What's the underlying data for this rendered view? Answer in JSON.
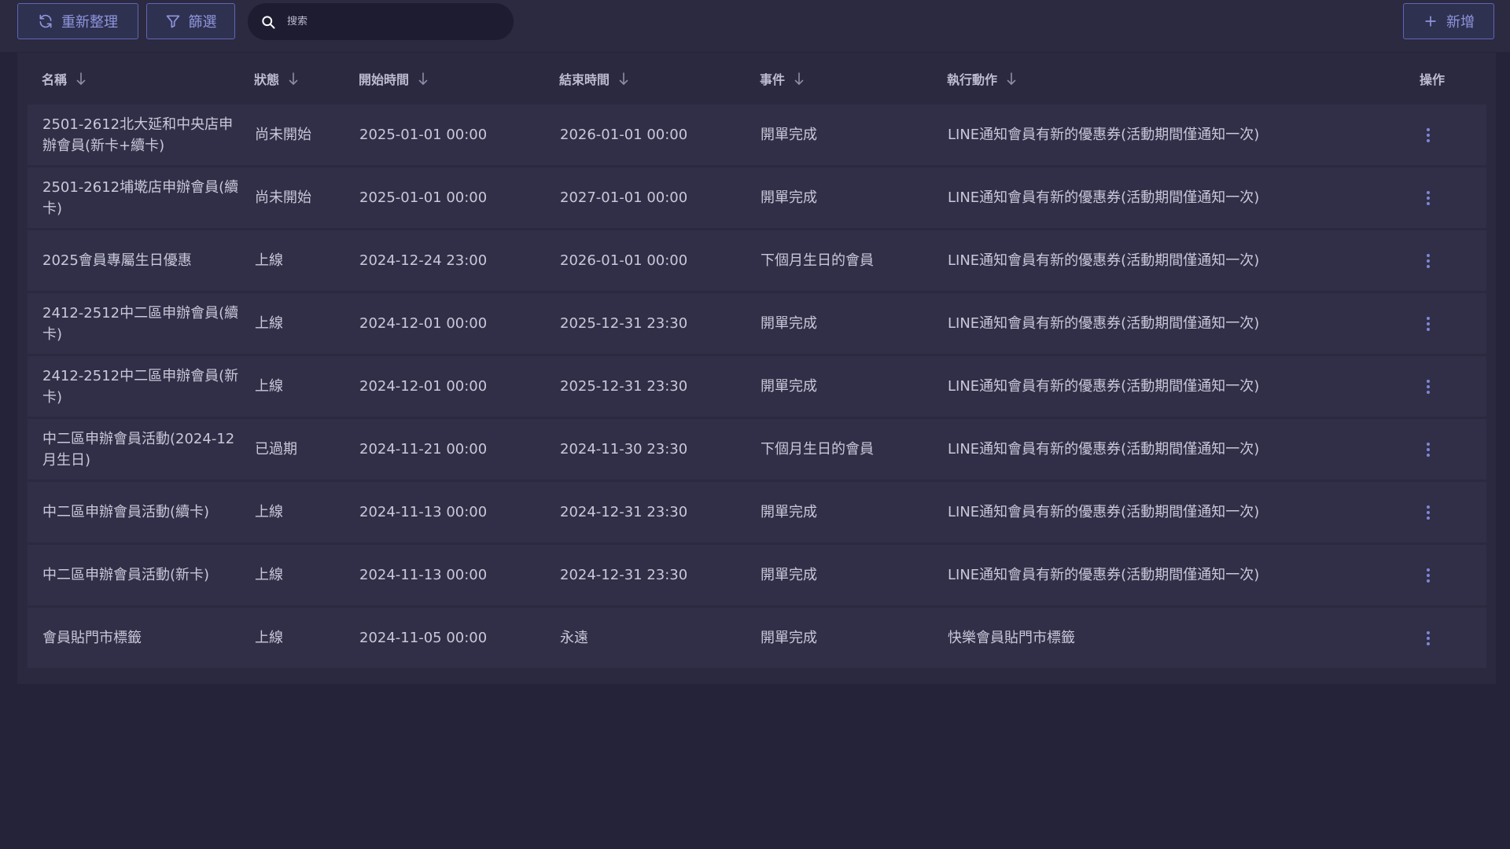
{
  "toolbar": {
    "refresh_label": "重新整理",
    "filter_label": "篩選",
    "add_label": "新增",
    "search_placeholder": "搜索"
  },
  "table": {
    "columns": [
      "名稱",
      "狀態",
      "開始時間",
      "結束時間",
      "事件",
      "執行動作",
      "操作"
    ],
    "rows": [
      {
        "name": "2501-2612北大延和中央店申辦會員(新卡+續卡)",
        "status": "尚未開始",
        "start": "2025-01-01 00:00",
        "end": "2026-01-01 00:00",
        "event": "開單完成",
        "action": "LINE通知會員有新的優惠券(活動期間僅通知一次)"
      },
      {
        "name": "2501-2612埔墘店申辦會員(續卡)",
        "status": "尚未開始",
        "start": "2025-01-01 00:00",
        "end": "2027-01-01 00:00",
        "event": "開單完成",
        "action": "LINE通知會員有新的優惠券(活動期間僅通知一次)"
      },
      {
        "name": "2025會員專屬生日優惠",
        "status": "上線",
        "start": "2024-12-24 23:00",
        "end": "2026-01-01 00:00",
        "event": "下個月生日的會員",
        "action": "LINE通知會員有新的優惠券(活動期間僅通知一次)"
      },
      {
        "name": "2412-2512中二區申辦會員(續卡)",
        "status": "上線",
        "start": "2024-12-01 00:00",
        "end": "2025-12-31 23:30",
        "event": "開單完成",
        "action": "LINE通知會員有新的優惠券(活動期間僅通知一次)"
      },
      {
        "name": "2412-2512中二區申辦會員(新卡)",
        "status": "上線",
        "start": "2024-12-01 00:00",
        "end": "2025-12-31 23:30",
        "event": "開單完成",
        "action": "LINE通知會員有新的優惠券(活動期間僅通知一次)"
      },
      {
        "name": "中二區申辦會員活動(2024-12月生日)",
        "status": "已過期",
        "start": "2024-11-21 00:00",
        "end": "2024-11-30 23:30",
        "event": "下個月生日的會員",
        "action": "LINE通知會員有新的優惠券(活動期間僅通知一次)"
      },
      {
        "name": "中二區申辦會員活動(續卡)",
        "status": "上線",
        "start": "2024-11-13 00:00",
        "end": "2024-12-31 23:30",
        "event": "開單完成",
        "action": "LINE通知會員有新的優惠券(活動期間僅通知一次)"
      },
      {
        "name": "中二區申辦會員活動(新卡)",
        "status": "上線",
        "start": "2024-11-13 00:00",
        "end": "2024-12-31 23:30",
        "event": "開單完成",
        "action": "LINE通知會員有新的優惠券(活動期間僅通知一次)"
      },
      {
        "name": "會員貼門市標籤",
        "status": "上線",
        "start": "2024-11-05 00:00",
        "end": "永遠",
        "event": "開單完成",
        "action": "快樂會員貼門市標籤"
      }
    ]
  },
  "colors": {
    "accent": "#8e95dc",
    "page_bg": "#24233a",
    "row_bg": "#302f47",
    "top_indicator": "#d8663f"
  }
}
